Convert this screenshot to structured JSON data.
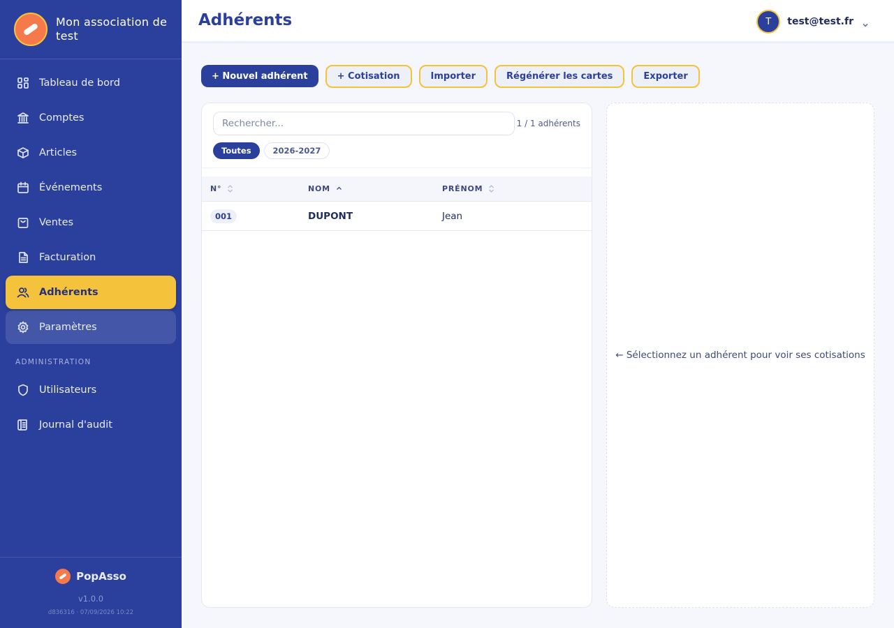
{
  "brand": {
    "name": "Mon association de test"
  },
  "nav": {
    "items": [
      {
        "label": "Tableau de bord"
      },
      {
        "label": "Comptes"
      },
      {
        "label": "Articles"
      },
      {
        "label": "Événements"
      },
      {
        "label": "Ventes"
      },
      {
        "label": "Facturation"
      },
      {
        "label": "Adhérents"
      },
      {
        "label": "Paramètres"
      }
    ],
    "admin_section": "ADMINISTRATION",
    "admin_items": [
      {
        "label": "Utilisateurs"
      },
      {
        "label": "Journal d'audit"
      }
    ]
  },
  "footer": {
    "product": "PopAsso",
    "version": "v1.0.0",
    "build": "d836316 · 07/09/2026 10:22"
  },
  "header": {
    "title": "Adhérents",
    "avatar_initial": "T",
    "user_email": "test@test.fr"
  },
  "toolbar": {
    "new_member": "+ Nouvel adhérent",
    "contribution": "+ Cotisation",
    "import": "Importer",
    "regenerate_cards": "Régénérer les cartes",
    "export": "Exporter"
  },
  "list": {
    "search_placeholder": "Rechercher...",
    "count": "1 / 1 adhérents",
    "chips": [
      "Toutes",
      "2026-2027"
    ],
    "columns": [
      "N°",
      "NOM",
      "PRÉNOM"
    ],
    "rows": [
      {
        "number": "001",
        "last_name": "DUPONT",
        "first_name": "Jean"
      }
    ]
  },
  "detail": {
    "hint": "← Sélectionnez un adhérent pour voir ses cotisations"
  },
  "colors": {
    "primary": "#2b3f9c",
    "accent": "#f5c23c",
    "logo": "#f5794a"
  }
}
